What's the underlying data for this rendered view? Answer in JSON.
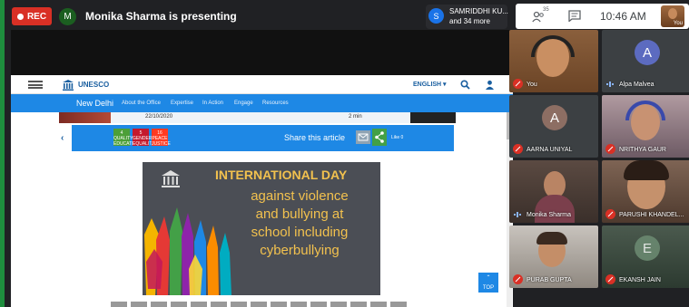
{
  "meeting": {
    "rec_label": "REC",
    "presenter_initial": "M",
    "presenter_text": "Monika Sharma is presenting",
    "others_initial": "S",
    "others_name": "SAMRIDDHI KU...",
    "others_more": "and 34 more",
    "people_count": "35",
    "time": "10:46 AM",
    "self_label": "You"
  },
  "shared_page": {
    "site_name": "UNESCO",
    "language": "ENGLISH ▾",
    "nav_title": "New Delhi",
    "nav_items": [
      "About the Office",
      "Expertise",
      "In Action",
      "Engage",
      "Resources"
    ],
    "date": "22/10/2020",
    "read_time": "2 min",
    "share_label": "Share this article",
    "like_label": "Like 0",
    "sdg_labels": [
      "4 QUALITY EDUCATION",
      "5 GENDER EQUALITY",
      "16 PEACE JUSTICE"
    ],
    "sdg_colors": [
      "#4c9f38",
      "#c5192d",
      "#ff3a21"
    ],
    "banner_heading": "INTERNATIONAL DAY",
    "banner_lines": [
      "against violence",
      "and bullying at",
      "school including",
      "cyberbullying"
    ],
    "top_button": "TOP"
  },
  "participants": [
    {
      "name": "You",
      "initial": "",
      "muted": true
    },
    {
      "name": "Alpa Malvea",
      "initial": "A",
      "muted": false
    },
    {
      "name": "AARNA UNIYAL",
      "initial": "A",
      "muted": true
    },
    {
      "name": "NRITHYA GAUR",
      "initial": "",
      "muted": true
    },
    {
      "name": "Monika Sharma",
      "initial": "",
      "muted": false
    },
    {
      "name": "PARUSHI KHANDEL...",
      "initial": "",
      "muted": true
    },
    {
      "name": "PURAB GUPTA",
      "initial": "",
      "muted": true
    },
    {
      "name": "EKANSH JAIN",
      "initial": "E",
      "muted": true
    }
  ],
  "colors": {
    "meet_bg": "#202124",
    "rec_red": "#d93025",
    "unesco_blue": "#1e88e5",
    "banner_yellow": "#f2c14e"
  }
}
